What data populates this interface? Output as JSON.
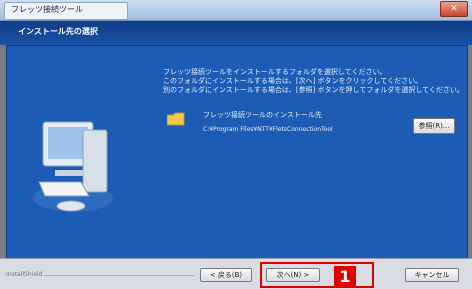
{
  "window": {
    "title": "フレッツ接続ツール",
    "close_label": "✕"
  },
  "header": {
    "title": "インストール先の選択"
  },
  "main": {
    "instructions": [
      "フレッツ接続ツールをインストールするフォルダを選択してください。",
      "このフォルダにインストールする場合は、[次へ] ボタンをクリックしてください。",
      "別のフォルダにインストールする場合は、[参照] ボタンを押してフォルダを選択してください。"
    ],
    "folder_label": "フレッツ接続ツールのインストール先",
    "folder_path": "C:¥Program Files¥NTT¥FletsConnectionTool",
    "browse_label": "参照(R)..."
  },
  "footer": {
    "brand": "InstallShield",
    "back_label": "< 戻る(B)",
    "next_label": "次へ(N) >",
    "cancel_label": "キャンセル"
  },
  "annotation": {
    "step_number": "1",
    "color": "#e00000"
  }
}
